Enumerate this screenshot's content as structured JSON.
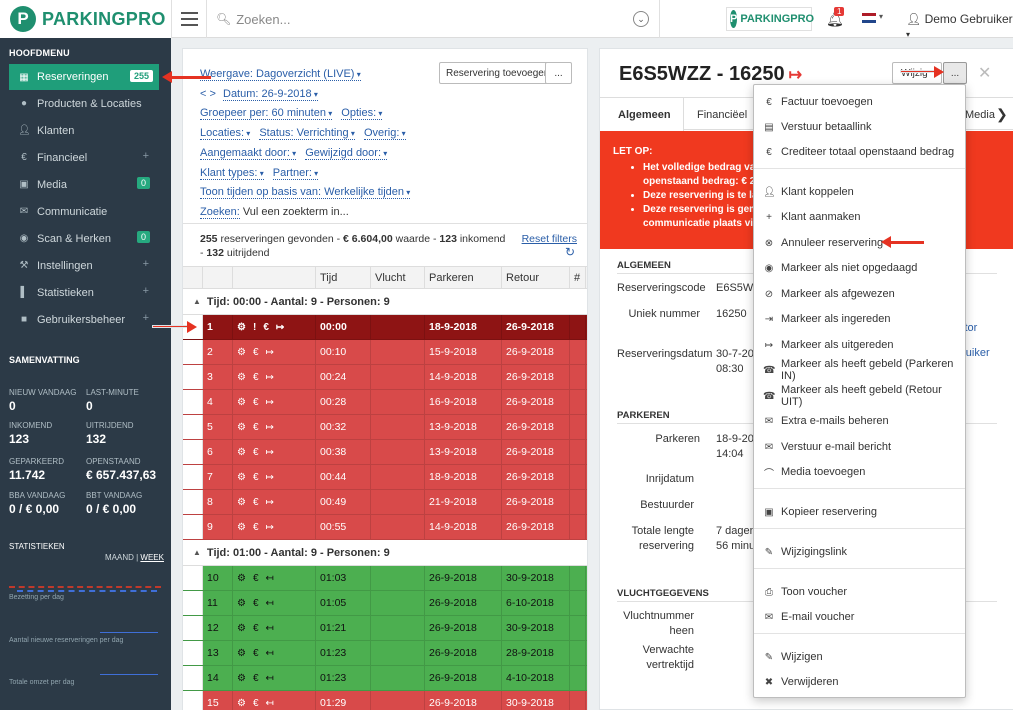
{
  "topbar": {
    "logo_text": "PARKINGPRO",
    "logo_letter": "P",
    "search_placeholder": "Zoeken...",
    "brand_small": "PARKINGPRO",
    "notification_count": "1",
    "user_name": "Demo Gebruiker",
    "flag_colors": [
      "#ae1c28",
      "#ffffff",
      "#21468b"
    ]
  },
  "sidebar": {
    "heading": "HOOFDMENU",
    "items": [
      {
        "label": "Reserveringen",
        "icon": "calendar-icon",
        "count": "255"
      },
      {
        "label": "Producten & Locaties",
        "icon": "map-marker-icon"
      },
      {
        "label": "Klanten",
        "icon": "user-icon"
      },
      {
        "label": "Financieel",
        "icon": "euro-icon"
      },
      {
        "label": "Media",
        "icon": "image-icon",
        "count": "0"
      },
      {
        "label": "Communicatie",
        "icon": "envelope-icon"
      },
      {
        "label": "Scan & Herken",
        "icon": "camera-icon",
        "count": "0"
      },
      {
        "label": "Instellingen",
        "icon": "wrench-icon"
      },
      {
        "label": "Statistieken",
        "icon": "bar-chart-icon"
      },
      {
        "label": "Gebruikersbeheer",
        "icon": "lock-icon"
      }
    ],
    "summary": {
      "heading": "SAMENVATTING",
      "stats": [
        {
          "label": "NIEUW VANDAAG",
          "value": "0"
        },
        {
          "label": "LAST-MINUTE",
          "value": "0"
        },
        {
          "label": "INKOMEND",
          "value": "123"
        },
        {
          "label": "UITRIJDEND",
          "value": "132"
        },
        {
          "label": "GEPARKEERD",
          "value": "11.742"
        },
        {
          "label": "OPENSTAAND",
          "value": "€ 657.437,63"
        },
        {
          "label": "BBA VANDAAG",
          "value": "0 / € 0,00"
        },
        {
          "label": "BBT VANDAAG",
          "value": "0 / € 0,00"
        }
      ]
    },
    "stats_section": {
      "heading": "STATISTIEKEN",
      "maand": "MAAND",
      "week": "WEEK",
      "charts": [
        "Bezetting per dag",
        "Aantal nieuwe reserveringen per dag",
        "Totale omzet per dag"
      ]
    }
  },
  "filters": {
    "weergave": "Weergave: Dagoverzicht (LIVE)",
    "datum": "Datum: 26-9-2018",
    "groepeer": "Groepeer per: 60 minuten",
    "opties": "Opties:",
    "locaties": "Locaties:",
    "status": "Status: Verrichting",
    "overig": "Overig:",
    "aangemaakt": "Aangemaakt door:",
    "gewijzigd": "Gewijzigd door:",
    "klanttypes": "Klant types:",
    "partner": "Partner:",
    "toon_tijden": "Toon tijden op basis van: Werkelijke tijden",
    "zoeken_label": "Zoeken:",
    "zoeken_placeholder": "Vul een zoekterm in...",
    "add_button": "Reservering toevoegen",
    "dots_button": "...",
    "date_prev": "<",
    "date_next": ">"
  },
  "results": {
    "count": "255",
    "count_text": "reserveringen gevonden -",
    "value": "€ 6.604,00",
    "value_text": "waarde -",
    "inkomend": "123",
    "inkomend_text": "inkomend",
    "uitrijdend": "132",
    "uitrijdend_text": "uitrijdend",
    "reset": "Reset filters"
  },
  "table": {
    "headers": [
      "",
      "",
      "Tijd",
      "Vlucht",
      "Parkeren",
      "Retour",
      "#"
    ],
    "groups": [
      {
        "title": "Tijd: 00:00 - Aantal: 9 - Personen: 9",
        "rows": [
          {
            "num": "1",
            "tijd": "00:00",
            "parkeren": "18-9-2018",
            "retour": "26-9-2018",
            "style": "darkred",
            "flags": "! € ↦"
          },
          {
            "num": "2",
            "tijd": "00:10",
            "parkeren": "15-9-2018",
            "retour": "26-9-2018",
            "style": "red",
            "flags": "€ ↦"
          },
          {
            "num": "3",
            "tijd": "00:24",
            "parkeren": "14-9-2018",
            "retour": "26-9-2018",
            "style": "red",
            "flags": "€ ↦"
          },
          {
            "num": "4",
            "tijd": "00:28",
            "parkeren": "16-9-2018",
            "retour": "26-9-2018",
            "style": "red",
            "flags": "€ ↦"
          },
          {
            "num": "5",
            "tijd": "00:32",
            "parkeren": "13-9-2018",
            "retour": "26-9-2018",
            "style": "red",
            "flags": "€ ↦"
          },
          {
            "num": "6",
            "tijd": "00:38",
            "parkeren": "13-9-2018",
            "retour": "26-9-2018",
            "style": "red",
            "flags": "€ ↦"
          },
          {
            "num": "7",
            "tijd": "00:44",
            "parkeren": "18-9-2018",
            "retour": "26-9-2018",
            "style": "red",
            "flags": "€ ↦"
          },
          {
            "num": "8",
            "tijd": "00:49",
            "parkeren": "21-9-2018",
            "retour": "26-9-2018",
            "style": "red",
            "flags": "€ ↦"
          },
          {
            "num": "9",
            "tijd": "00:55",
            "parkeren": "14-9-2018",
            "retour": "26-9-2018",
            "style": "red",
            "flags": "€ ↦"
          }
        ]
      },
      {
        "title": "Tijd: 01:00 - Aantal: 9 - Personen: 9",
        "rows": [
          {
            "num": "10",
            "tijd": "01:03",
            "parkeren": "26-9-2018",
            "retour": "30-9-2018",
            "style": "green",
            "flags": "€ ↤"
          },
          {
            "num": "11",
            "tijd": "01:05",
            "parkeren": "26-9-2018",
            "retour": "6-10-2018",
            "style": "green",
            "flags": "€ ↤"
          },
          {
            "num": "12",
            "tijd": "01:21",
            "parkeren": "26-9-2018",
            "retour": "30-9-2018",
            "style": "green",
            "flags": "€ ↤"
          },
          {
            "num": "13",
            "tijd": "01:23",
            "parkeren": "26-9-2018",
            "retour": "28-9-2018",
            "style": "green",
            "flags": "€ ↤"
          },
          {
            "num": "14",
            "tijd": "01:23",
            "parkeren": "26-9-2018",
            "retour": "4-10-2018",
            "style": "green",
            "flags": "€ ↤"
          },
          {
            "num": "15",
            "tijd": "01:29",
            "parkeren": "26-9-2018",
            "retour": "30-9-2018",
            "style": "red",
            "flags": "€ ↤"
          }
        ]
      }
    ]
  },
  "detail": {
    "title": "E6S5WZZ - 16250",
    "wijzig": "Wijzig",
    "dots": "...",
    "tabs": [
      "Algemeen",
      "Financiëel",
      "Media"
    ],
    "warning": {
      "heading": "LET OP:",
      "items": [
        "Het volledige bedrag va",
        "openstaand bedrag: € 2",
        "Deze reservering is te la",
        "Deze reservering is gem",
        "communicatie plaats vi"
      ]
    },
    "algemeen": {
      "heading": "ALGEMEEN",
      "reserveringscode_label": "Reserveringscode",
      "reserveringscode": "E6S5W",
      "uniek_label": "Uniek nummer",
      "uniek": "16250",
      "datum_label": "Reserveringsdatum",
      "datum_line1": "30-7-20",
      "datum_line2": "08:30",
      "link1": "itor",
      "link2": "bruiker"
    },
    "parkeren": {
      "heading": "PARKEREN",
      "parkeren_label": "Parkeren",
      "parkeren_line1": "18-9-20",
      "parkeren_line2": "14:04",
      "inrij_label": "Inrijdatum",
      "bestuurder_label": "Bestuurder",
      "totale_label_1": "Totale lengte",
      "totale_label_2": "reservering",
      "totale_line1": "7 dagen",
      "totale_line2": "56 minu"
    },
    "vlucht": {
      "heading": "VLUCHTGEGEVENS",
      "vluchtnummer_1": "Vluchtnummer",
      "vluchtnummer_2": "heen",
      "verwachte_1": "Verwachte",
      "verwachte_2": "vertrektijd"
    }
  },
  "menu": {
    "items": [
      {
        "label": "Factuur toevoegen",
        "icon": "euro-icon"
      },
      {
        "label": "Verstuur betaallink",
        "icon": "credit-card-icon"
      },
      {
        "label": "Crediteer totaal openstaand bedrag",
        "icon": "euro-icon"
      },
      {
        "label": "Klant koppelen",
        "icon": "user-icon"
      },
      {
        "label": "Klant aanmaken",
        "icon": "plus-icon"
      },
      {
        "label": "Annuleer reservering",
        "icon": "cancel-circle-icon"
      },
      {
        "label": "Markeer als niet opgedaagd",
        "icon": "eye-slash-icon"
      },
      {
        "label": "Markeer als afgewezen",
        "icon": "ban-icon"
      },
      {
        "label": "Markeer als ingereden",
        "icon": "sign-in-icon"
      },
      {
        "label": "Markeer als uitgereden",
        "icon": "sign-out-icon"
      },
      {
        "label": "Markeer als heeft gebeld (Parkeren IN)",
        "icon": "phone-icon"
      },
      {
        "label": "Markeer als heeft gebeld (Retour UIT)",
        "icon": "phone-icon"
      },
      {
        "label": "Extra e-mails beheren",
        "icon": "envelope-icon"
      },
      {
        "label": "Verstuur e-mail bericht",
        "icon": "envelope-icon"
      },
      {
        "label": "Media toevoegen",
        "icon": "paperclip-icon"
      },
      {
        "label": "Kopieer reservering",
        "icon": "copy-icon"
      },
      {
        "label": "Wijzigingslink",
        "icon": "pencil-icon"
      },
      {
        "label": "Toon voucher",
        "icon": "print-icon"
      },
      {
        "label": "E-mail voucher",
        "icon": "envelope-icon"
      },
      {
        "label": "Wijzigen",
        "icon": "pencil-icon"
      },
      {
        "label": "Verwijderen",
        "icon": "times-icon"
      }
    ]
  },
  "colors": {
    "accent": "#1f9e7a",
    "sidebar_bg": "#2c3a47",
    "row_red": "#d84a4a",
    "row_darkred": "#8e1414",
    "row_green": "#4caf50",
    "warning_bg": "#f0391f",
    "arrow": "#e53222"
  }
}
